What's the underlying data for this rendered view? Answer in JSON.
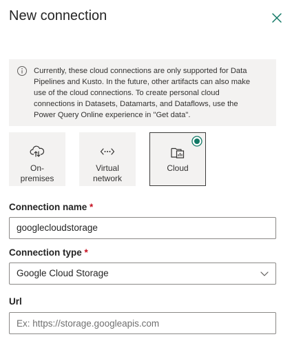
{
  "header": {
    "title": "New connection",
    "close_icon": "close-icon"
  },
  "info": {
    "icon": "info-icon",
    "line1": "Currently, these cloud connections are only supported for Data",
    "line2": "Pipelines and Kusto. In the future, other artifacts can also make",
    "line3": "use of the cloud connections. To create personal cloud",
    "line4": "connections in Datasets, Datamarts, and Dataflows, use the",
    "line5": "Power Query Online experience in \"Get data\"."
  },
  "connection_kinds": [
    {
      "line1": "On-",
      "line2": "premises",
      "icon": "cloud-upload-icon",
      "selected": false
    },
    {
      "line1": "Virtual",
      "line2": "network",
      "icon": "network-icon",
      "selected": false
    },
    {
      "line1": "Cloud",
      "line2": "",
      "icon": "cloud-folder-icon",
      "selected": true
    }
  ],
  "form": {
    "connection_name": {
      "label": "Connection name",
      "required_mark": "*",
      "value": "googlecloudstorage"
    },
    "connection_type": {
      "label": "Connection type",
      "required_mark": "*",
      "value": "Google Cloud Storage",
      "icon": "chevron-down-icon"
    },
    "url": {
      "label": "Url",
      "value": "",
      "placeholder": "Ex: https://storage.googleapis.com"
    }
  },
  "colors": {
    "accent": "#117865",
    "required": "#c50f1f",
    "panel_bg": "#f3f2f1"
  }
}
